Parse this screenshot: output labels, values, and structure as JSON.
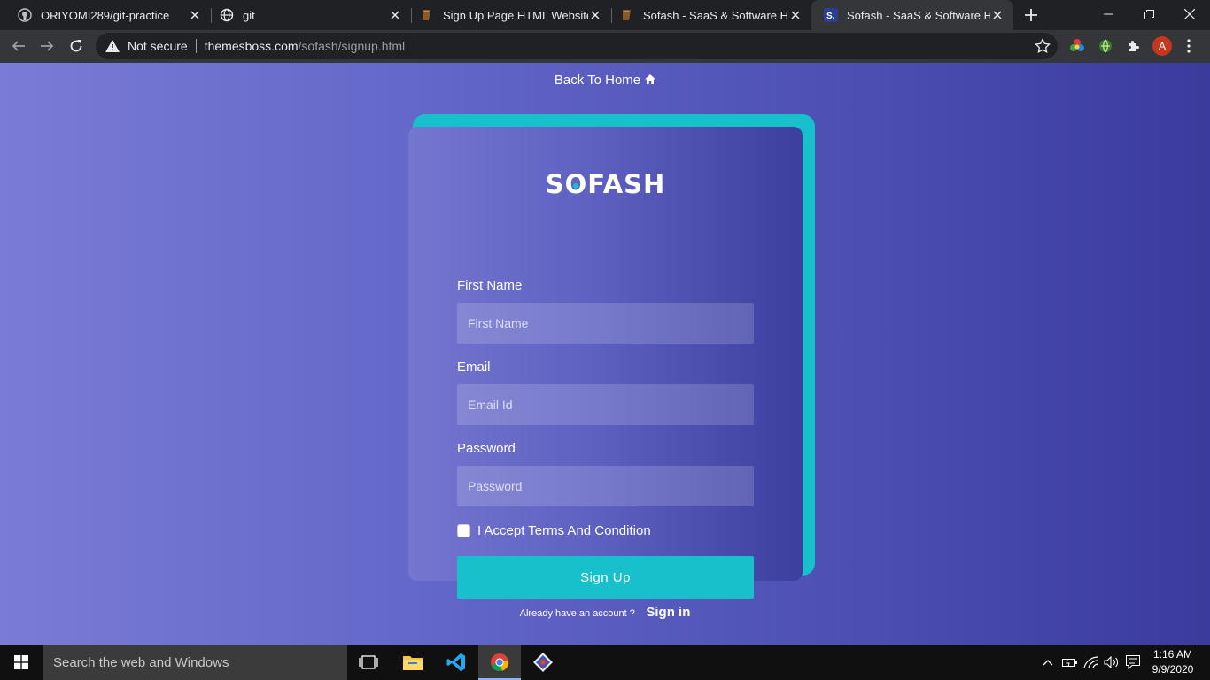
{
  "browser": {
    "tabs": [
      {
        "title": "ORIYOMI289/git-practice",
        "favicon": "github-icon",
        "active": false
      },
      {
        "title": "git",
        "favicon": "globe-icon",
        "active": false
      },
      {
        "title": "Sign Up Page HTML Website Te",
        "favicon": "bookmark-icon",
        "active": false
      },
      {
        "title": "Sofash - SaaS & Software HTM",
        "favicon": "bookmark-icon",
        "active": false
      },
      {
        "title": "Sofash - SaaS & Software Htm",
        "favicon": "sofash-icon",
        "active": true
      }
    ],
    "security_label": "Not secure",
    "url_host": "themesboss.com",
    "url_path": "/sofash/signup.html",
    "profile_initial": "A"
  },
  "page": {
    "back_home": "Back To Home",
    "logo_parts": {
      "pre": "S",
      "o": "O",
      "post": "FASH"
    },
    "form": {
      "first_name_label": "First Name",
      "first_name_placeholder": "First Name",
      "email_label": "Email",
      "email_placeholder": "Email Id",
      "password_label": "Password",
      "password_placeholder": "Password",
      "terms_label": "I Accept Terms And Condition",
      "submit_label": "Sign Up"
    },
    "already_text": "Already have an account ?",
    "signin_label": "Sign in",
    "colors": {
      "accent": "#18c0cc",
      "bg_left": "#7a7bd6",
      "bg_right": "#3a3b9c"
    }
  },
  "taskbar": {
    "search_placeholder": "Search the web and Windows",
    "time": "1:16 AM",
    "date": "9/9/2020"
  }
}
